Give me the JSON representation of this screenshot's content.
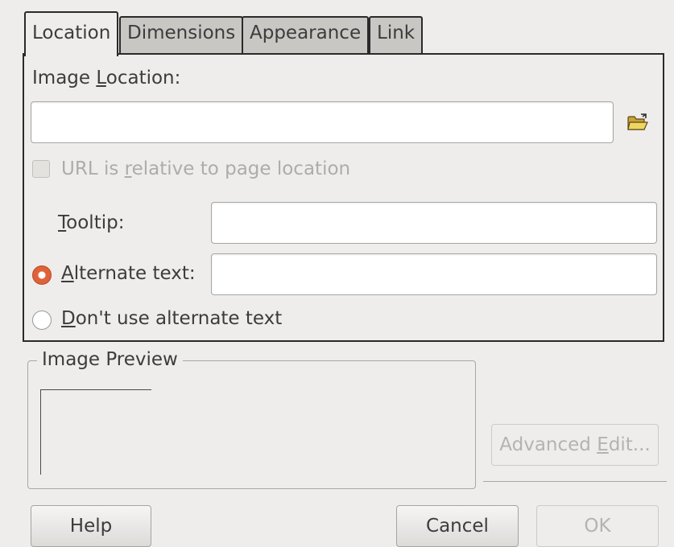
{
  "tabs": [
    {
      "label": "Location",
      "active": true
    },
    {
      "label": "Dimensions",
      "active": false
    },
    {
      "label": "Appearance",
      "active": false
    },
    {
      "label": "Link",
      "active": false
    }
  ],
  "location": {
    "image_location_label_pre": "Image ",
    "image_location_label_mn": "L",
    "image_location_label_post": "ocation:",
    "image_location_value": "",
    "browse_icon": "folder-open-icon",
    "relative_checkbox": {
      "pre": "URL is ",
      "mn": "r",
      "post": "elative to page location",
      "checked": false,
      "enabled": false
    },
    "tooltip": {
      "mn": "T",
      "post": "ooltip:",
      "value": ""
    },
    "alternate_text": {
      "mn": "A",
      "post": "lternate text:",
      "value": "",
      "selected": true
    },
    "no_alternate_text": {
      "mn": "D",
      "post": "on't use alternate text",
      "selected": false
    }
  },
  "preview": {
    "legend": "Image Preview"
  },
  "buttons": {
    "advanced_edit_pre": "Advanced ",
    "advanced_edit_mn": "E",
    "advanced_edit_post": "dit...",
    "help": "Help",
    "cancel": "Cancel",
    "ok": "OK"
  },
  "colors": {
    "radio_selected": "#e0623a",
    "background": "#efedeb"
  }
}
